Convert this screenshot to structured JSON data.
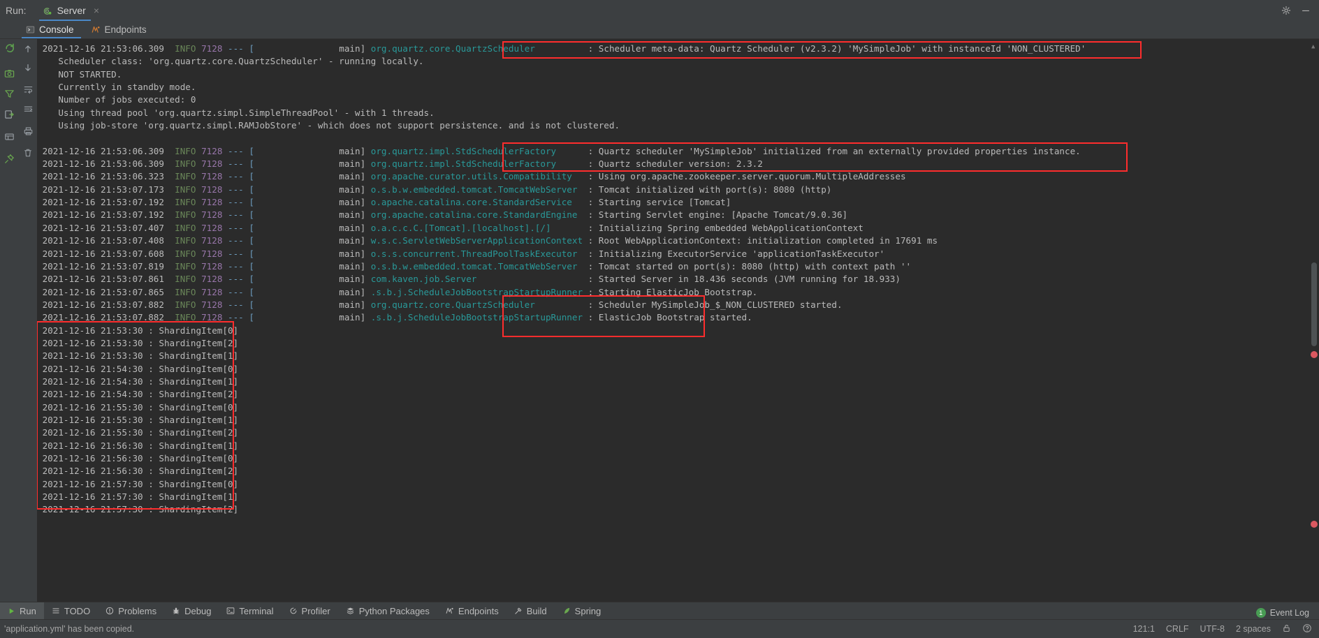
{
  "window": {
    "run_label": "Run:",
    "run_tab": "Server",
    "close_glyph": "×",
    "gear_icon": "gear-icon",
    "minimize_icon": "minimize-icon"
  },
  "tool_tabs": [
    {
      "label": "Console",
      "icon": "console-icon",
      "active": true
    },
    {
      "label": "Endpoints",
      "icon": "endpoints-icon",
      "active": false
    }
  ],
  "left_gutter_icons": [
    "rerun-icon",
    "camera-icon",
    "filter-icon",
    "export-icon",
    "grid-icon",
    "pin-icon"
  ],
  "left_gutter2_icons": [
    "scroll-up-icon",
    "scroll-down-icon",
    "soft-wrap-icon",
    "scroll-end-icon",
    "print-icon",
    "trash-icon"
  ],
  "console": {
    "lines": [
      {
        "type": "log",
        "ts": "2021-12-16 21:53:06.309",
        "level": "INFO",
        "pid": "7128",
        "sep": "--- [",
        "thread": "main]",
        "cls": "org.quartz.core.QuartzScheduler",
        "colon": ":",
        "msg": "Scheduler meta-data: Quartz Scheduler (v2.3.2) 'MySimpleJob' with instanceId 'NON_CLUSTERED'"
      },
      {
        "type": "plain",
        "text": "   Scheduler class: 'org.quartz.core.QuartzScheduler' - running locally."
      },
      {
        "type": "plain",
        "text": "   NOT STARTED."
      },
      {
        "type": "plain",
        "text": "   Currently in standby mode."
      },
      {
        "type": "plain",
        "text": "   Number of jobs executed: 0"
      },
      {
        "type": "plain",
        "text": "   Using thread pool 'org.quartz.simpl.SimpleThreadPool' - with 1 threads."
      },
      {
        "type": "plain",
        "text": "   Using job-store 'org.quartz.simpl.RAMJobStore' - which does not support persistence. and is not clustered."
      },
      {
        "type": "blank",
        "text": ""
      },
      {
        "type": "log",
        "ts": "2021-12-16 21:53:06.309",
        "level": "INFO",
        "pid": "7128",
        "sep": "--- [",
        "thread": "main]",
        "cls": "org.quartz.impl.StdSchedulerFactory",
        "colon": ":",
        "msg": "Quartz scheduler 'MySimpleJob' initialized from an externally provided properties instance."
      },
      {
        "type": "log",
        "ts": "2021-12-16 21:53:06.309",
        "level": "INFO",
        "pid": "7128",
        "sep": "--- [",
        "thread": "main]",
        "cls": "org.quartz.impl.StdSchedulerFactory",
        "colon": ":",
        "msg": "Quartz scheduler version: 2.3.2"
      },
      {
        "type": "log",
        "ts": "2021-12-16 21:53:06.323",
        "level": "INFO",
        "pid": "7128",
        "sep": "--- [",
        "thread": "main]",
        "cls": "org.apache.curator.utils.Compatibility",
        "colon": ":",
        "msg": "Using org.apache.zookeeper.server.quorum.MultipleAddresses"
      },
      {
        "type": "log",
        "ts": "2021-12-16 21:53:07.173",
        "level": "INFO",
        "pid": "7128",
        "sep": "--- [",
        "thread": "main]",
        "cls": "o.s.b.w.embedded.tomcat.TomcatWebServer",
        "colon": ":",
        "msg": "Tomcat initialized with port(s): 8080 (http)"
      },
      {
        "type": "log",
        "ts": "2021-12-16 21:53:07.192",
        "level": "INFO",
        "pid": "7128",
        "sep": "--- [",
        "thread": "main]",
        "cls": "o.apache.catalina.core.StandardService",
        "colon": ":",
        "msg": "Starting service [Tomcat]"
      },
      {
        "type": "log",
        "ts": "2021-12-16 21:53:07.192",
        "level": "INFO",
        "pid": "7128",
        "sep": "--- [",
        "thread": "main]",
        "cls": "org.apache.catalina.core.StandardEngine",
        "colon": ":",
        "msg": "Starting Servlet engine: [Apache Tomcat/9.0.36]"
      },
      {
        "type": "log",
        "ts": "2021-12-16 21:53:07.407",
        "level": "INFO",
        "pid": "7128",
        "sep": "--- [",
        "thread": "main]",
        "cls": "o.a.c.c.C.[Tomcat].[localhost].[/]",
        "colon": ":",
        "msg": "Initializing Spring embedded WebApplicationContext"
      },
      {
        "type": "log",
        "ts": "2021-12-16 21:53:07.408",
        "level": "INFO",
        "pid": "7128",
        "sep": "--- [",
        "thread": "main]",
        "cls": "w.s.c.ServletWebServerApplicationContext",
        "colon": ":",
        "msg": "Root WebApplicationContext: initialization completed in 17691 ms"
      },
      {
        "type": "log",
        "ts": "2021-12-16 21:53:07.608",
        "level": "INFO",
        "pid": "7128",
        "sep": "--- [",
        "thread": "main]",
        "cls": "o.s.s.concurrent.ThreadPoolTaskExecutor",
        "colon": ":",
        "msg": "Initializing ExecutorService 'applicationTaskExecutor'"
      },
      {
        "type": "log",
        "ts": "2021-12-16 21:53:07.819",
        "level": "INFO",
        "pid": "7128",
        "sep": "--- [",
        "thread": "main]",
        "cls": "o.s.b.w.embedded.tomcat.TomcatWebServer",
        "colon": ":",
        "msg": "Tomcat started on port(s): 8080 (http) with context path ''"
      },
      {
        "type": "log",
        "ts": "2021-12-16 21:53:07.861",
        "level": "INFO",
        "pid": "7128",
        "sep": "--- [",
        "thread": "main]",
        "cls": "com.kaven.job.Server",
        "colon": ":",
        "msg": "Started Server in 18.436 seconds (JVM running for 18.933)"
      },
      {
        "type": "log",
        "ts": "2021-12-16 21:53:07.865",
        "level": "INFO",
        "pid": "7128",
        "sep": "--- [",
        "thread": "main]",
        "cls": ".s.b.j.ScheduleJobBootstrapStartupRunner",
        "colon": ":",
        "msg": "Starting ElasticJob Bootstrap."
      },
      {
        "type": "log",
        "ts": "2021-12-16 21:53:07.882",
        "level": "INFO",
        "pid": "7128",
        "sep": "--- [",
        "thread": "main]",
        "cls": "org.quartz.core.QuartzScheduler",
        "colon": ":",
        "msg": "Scheduler MySimpleJob_$_NON_CLUSTERED started."
      },
      {
        "type": "log",
        "ts": "2021-12-16 21:53:07.882",
        "level": "INFO",
        "pid": "7128",
        "sep": "--- [",
        "thread": "main]",
        "cls": ".s.b.j.ScheduleJobBootstrapStartupRunner",
        "colon": ":",
        "msg": "ElasticJob Bootstrap started."
      },
      {
        "type": "plain",
        "text": "2021-12-16 21:53:30 : ShardingItem[0]"
      },
      {
        "type": "plain",
        "text": "2021-12-16 21:53:30 : ShardingItem[2]"
      },
      {
        "type": "plain",
        "text": "2021-12-16 21:53:30 : ShardingItem[1]"
      },
      {
        "type": "plain",
        "text": "2021-12-16 21:54:30 : ShardingItem[0]"
      },
      {
        "type": "plain",
        "text": "2021-12-16 21:54:30 : ShardingItem[1]"
      },
      {
        "type": "plain",
        "text": "2021-12-16 21:54:30 : ShardingItem[2]"
      },
      {
        "type": "plain",
        "text": "2021-12-16 21:55:30 : ShardingItem[0]"
      },
      {
        "type": "plain",
        "text": "2021-12-16 21:55:30 : ShardingItem[1]"
      },
      {
        "type": "plain",
        "text": "2021-12-16 21:55:30 : ShardingItem[2]"
      },
      {
        "type": "plain",
        "text": "2021-12-16 21:56:30 : ShardingItem[1]"
      },
      {
        "type": "plain",
        "text": "2021-12-16 21:56:30 : ShardingItem[0]"
      },
      {
        "type": "plain",
        "text": "2021-12-16 21:56:30 : ShardingItem[2]"
      },
      {
        "type": "plain",
        "text": "2021-12-16 21:57:30 : ShardingItem[0]"
      },
      {
        "type": "plain",
        "text": "2021-12-16 21:57:30 : ShardingItem[1]"
      },
      {
        "type": "plain",
        "text": "2021-12-16 21:57:30 : ShardingItem[2]"
      }
    ],
    "highlight_color": "#ff2d2d"
  },
  "bottom_tabs": [
    {
      "label": "Run",
      "icon": "play-icon",
      "active": true
    },
    {
      "label": "TODO",
      "icon": "list-icon",
      "active": false
    },
    {
      "label": "Problems",
      "icon": "warning-icon",
      "active": false
    },
    {
      "label": "Debug",
      "icon": "bug-icon",
      "active": false
    },
    {
      "label": "Terminal",
      "icon": "terminal-icon",
      "active": false
    },
    {
      "label": "Profiler",
      "icon": "profiler-icon",
      "active": false
    },
    {
      "label": "Python Packages",
      "icon": "packages-icon",
      "active": false
    },
    {
      "label": "Endpoints",
      "icon": "endpoints-icon",
      "active": false
    },
    {
      "label": "Build",
      "icon": "hammer-icon",
      "active": false
    },
    {
      "label": "Spring",
      "icon": "spring-leaf-icon",
      "active": false
    }
  ],
  "status": {
    "message": "'application.yml' has been copied.",
    "event_log": "Event Log",
    "event_log_count": "1",
    "caret": "121:1",
    "line_sep": "CRLF",
    "encoding": "UTF-8",
    "indent": "2 spaces",
    "lock_icon": "unlocked-icon",
    "help_icon": "help-icon"
  }
}
